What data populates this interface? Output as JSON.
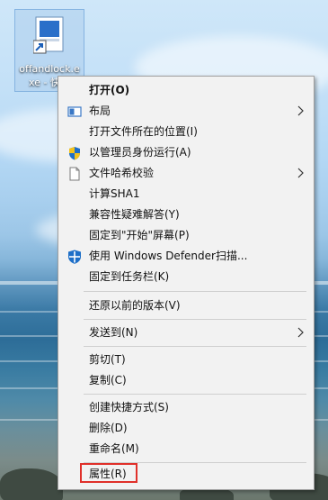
{
  "desktop_icon": {
    "caption": "offandlock.e\nxe - 快捷",
    "icon": "shortcut-file-icon"
  },
  "menu": {
    "items": [
      {
        "label": "打开(O)",
        "bold": true
      },
      {
        "label": "布局",
        "icon": "layout-icon",
        "submenu": true
      },
      {
        "label": "打开文件所在的位置(I)"
      },
      {
        "label": "以管理员身份运行(A)",
        "icon": "uac-shield-icon"
      },
      {
        "label": "文件哈希校验",
        "icon": "file-icon",
        "submenu": true
      },
      {
        "label": "计算SHA1"
      },
      {
        "label": "兼容性疑难解答(Y)"
      },
      {
        "label": "固定到\"开始\"屏幕(P)"
      },
      {
        "label": "使用 Windows Defender扫描...",
        "icon": "defender-icon"
      },
      {
        "label": "固定到任务栏(K)"
      },
      {
        "label": "还原以前的版本(V)"
      },
      {
        "label": "发送到(N)",
        "submenu": true
      },
      {
        "label": "剪切(T)"
      },
      {
        "label": "复制(C)"
      },
      {
        "label": "创建快捷方式(S)"
      },
      {
        "label": "删除(D)"
      },
      {
        "label": "重命名(M)"
      },
      {
        "label": "属性(R)",
        "highlighted": true
      }
    ]
  },
  "colors": {
    "menu_background": "#f2f2f2",
    "highlight_border": "#e0302a",
    "shield_blue": "#1e6fc8",
    "shield_yellow": "#f3c21c"
  }
}
